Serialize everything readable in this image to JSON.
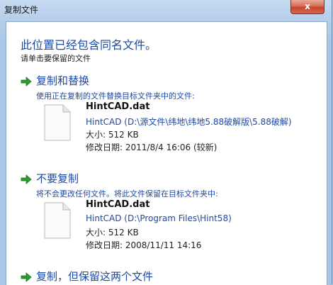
{
  "window": {
    "title": "复制文件",
    "close_label": "x"
  },
  "headline": "此位置已经包含同名文件。",
  "subline": "请单击要保留的文件",
  "options": [
    {
      "title": "复制和替换",
      "desc": "使用正在复制的文件替换目标文件夹中的文件:",
      "file": {
        "name": "HintCAD.dat",
        "path": "HintCAD (D:\\源文件\\纬地\\纬地5.88破解版\\5.88破解)",
        "size": "大小: 512 KB",
        "modified": "修改日期: 2011/8/4 16:06 (较新)"
      }
    },
    {
      "title": "不要复制",
      "desc": "将不会更改任何文件。将此文件保留在目标文件夹中:",
      "file": {
        "name": "HintCAD.dat",
        "path": "HintCAD (D:\\Program Files\\Hint58)",
        "size": "大小: 512 KB",
        "modified": "修改日期: 2008/11/11 14:16"
      }
    },
    {
      "title": "复制，但保留这两个文件"
    }
  ],
  "colors": {
    "link_blue": "#1d49a6",
    "arrow_green": "#2e9a2e"
  },
  "icons": {
    "option_arrow": "green-arrow-icon",
    "file": "file-icon"
  }
}
